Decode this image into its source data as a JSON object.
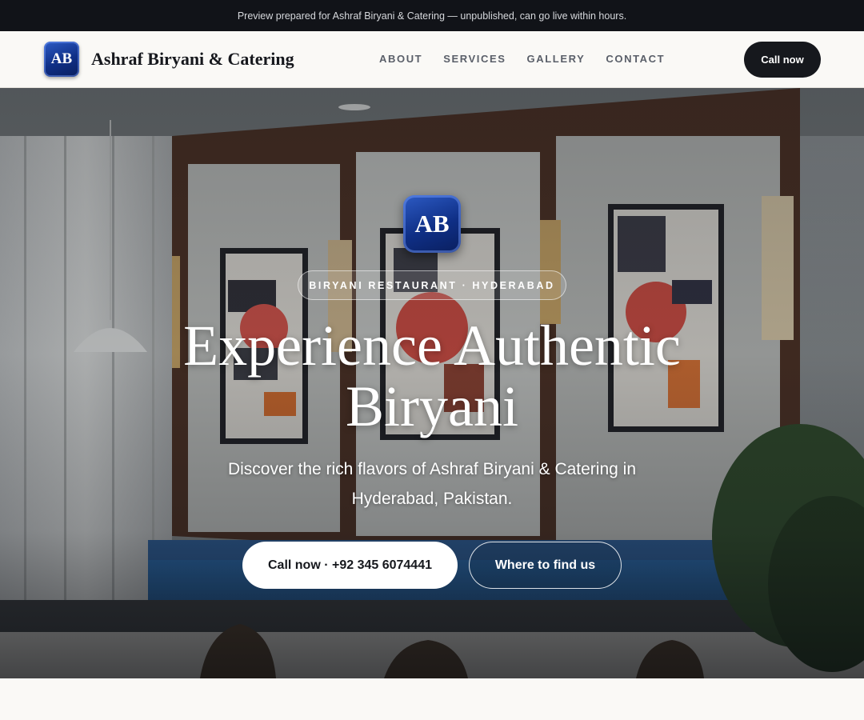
{
  "announcement": "Preview prepared for Ashraf Biryani & Catering — unpublished, can go live within hours.",
  "header": {
    "logo_text": "AB",
    "brand_name": "Ashraf Biryani & Catering",
    "nav": [
      "ABOUT",
      "SERVICES",
      "GALLERY",
      "CONTACT"
    ],
    "call_label": "Call now"
  },
  "hero": {
    "logo_text": "AB",
    "tagline": "BIRYANI RESTAURANT · HYDERABAD",
    "title": "Experience Authentic Biryani",
    "subtitle": "Discover the rich flavors of Ashraf Biryani & Catering in Hyderabad, Pakistan.",
    "primary_cta": "Call now · +92 345 6074441",
    "secondary_cta": "Where to find us",
    "background_description_icon": "restaurant-interior-photo"
  },
  "colors": {
    "dark": "#111318",
    "logo_blue": "#0f2f86",
    "page_bg": "#faf9f6",
    "seat_blue": "#1f5a9a"
  }
}
